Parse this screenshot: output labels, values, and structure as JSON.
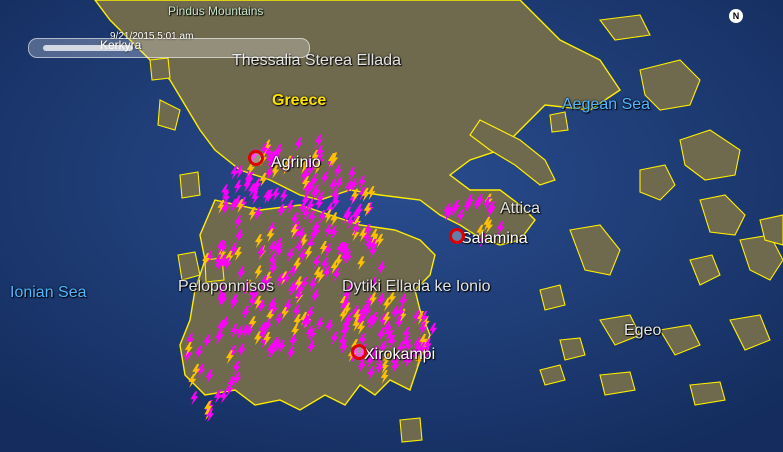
{
  "map": {
    "timestamp": "9/21/2015   5:01 am",
    "compass_letter": "N",
    "labels": {
      "pindus": "Pindus Mountains",
      "kerkyra": "Kerkyra",
      "thessalia": "Thessalia Sterea Ellada",
      "greece": "Greece",
      "aegean": "Aegean Sea",
      "agrinio": "Agrinio",
      "attica": "Attica",
      "salamina": "Salamina",
      "ionian": "Ionian Sea",
      "peloponnisos": "Peloponnisos",
      "dytiki": "Dytiki Ellada ke Ionio",
      "egeo": "Egeo",
      "xirokampi": "Xirokampi"
    },
    "colors": {
      "sea": "#1f3f7a",
      "land": "#6f6a4e",
      "coastline": "#ffee00",
      "lightning_recent": "#ff00ff",
      "lightning_older": "#ffc000",
      "marker": "#dd0000"
    },
    "icons": [
      "lightning-strike-icon",
      "city-marker-icon",
      "compass-icon",
      "time-slider"
    ]
  }
}
